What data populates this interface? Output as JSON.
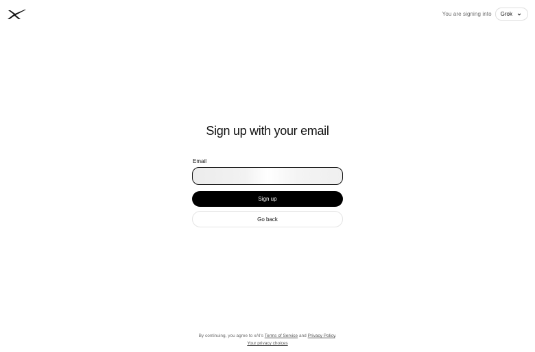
{
  "header": {
    "logo_name": "xAI",
    "signing_into_text": "You are signing into",
    "product_selected": "Grok"
  },
  "main": {
    "title": "Sign up with your email",
    "email_label": "Email",
    "email_value": "",
    "signup_label": "Sign up",
    "go_back_label": "Go back"
  },
  "footer": {
    "prefix": "By continuing, you agree to xAI's",
    "terms_label": "Terms of Service",
    "and_text": "and",
    "privacy_label": "Privacy Policy",
    "period": ".",
    "privacy_choices_label": "Your privacy choices"
  },
  "colors": {
    "primary_button": "#000000",
    "text": "#111111",
    "muted_text": "#6b6b6b"
  }
}
